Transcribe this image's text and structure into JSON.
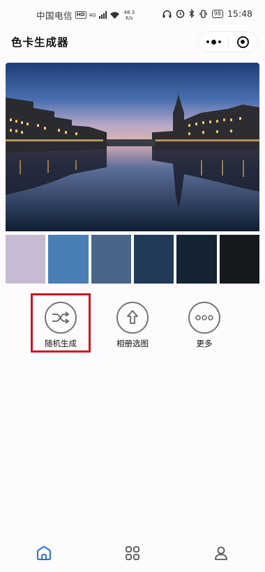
{
  "status_bar": {
    "carrier": "中国电信",
    "hd": "HD",
    "network": "4G",
    "speed_value": "48.3",
    "speed_unit": "K/s",
    "battery": "98",
    "time": "15:48"
  },
  "app": {
    "title": "色卡生成器"
  },
  "palette": {
    "colors": [
      "#c6bbd2",
      "#4a7fb6",
      "#4b6489",
      "#213a58",
      "#142435",
      "#15181d"
    ]
  },
  "actions": [
    {
      "label": "随机生成",
      "icon": "shuffle-icon"
    },
    {
      "label": "相册选图",
      "icon": "upload-icon"
    },
    {
      "label": "更多",
      "icon": "more-dots-icon"
    }
  ],
  "tabbar": {
    "items": [
      {
        "icon": "home-icon",
        "active": true
      },
      {
        "icon": "grid-icon",
        "active": false
      },
      {
        "icon": "user-icon",
        "active": false
      }
    ]
  },
  "colors": {
    "accent": "#2a6fdb",
    "highlight": "#d0141b"
  }
}
